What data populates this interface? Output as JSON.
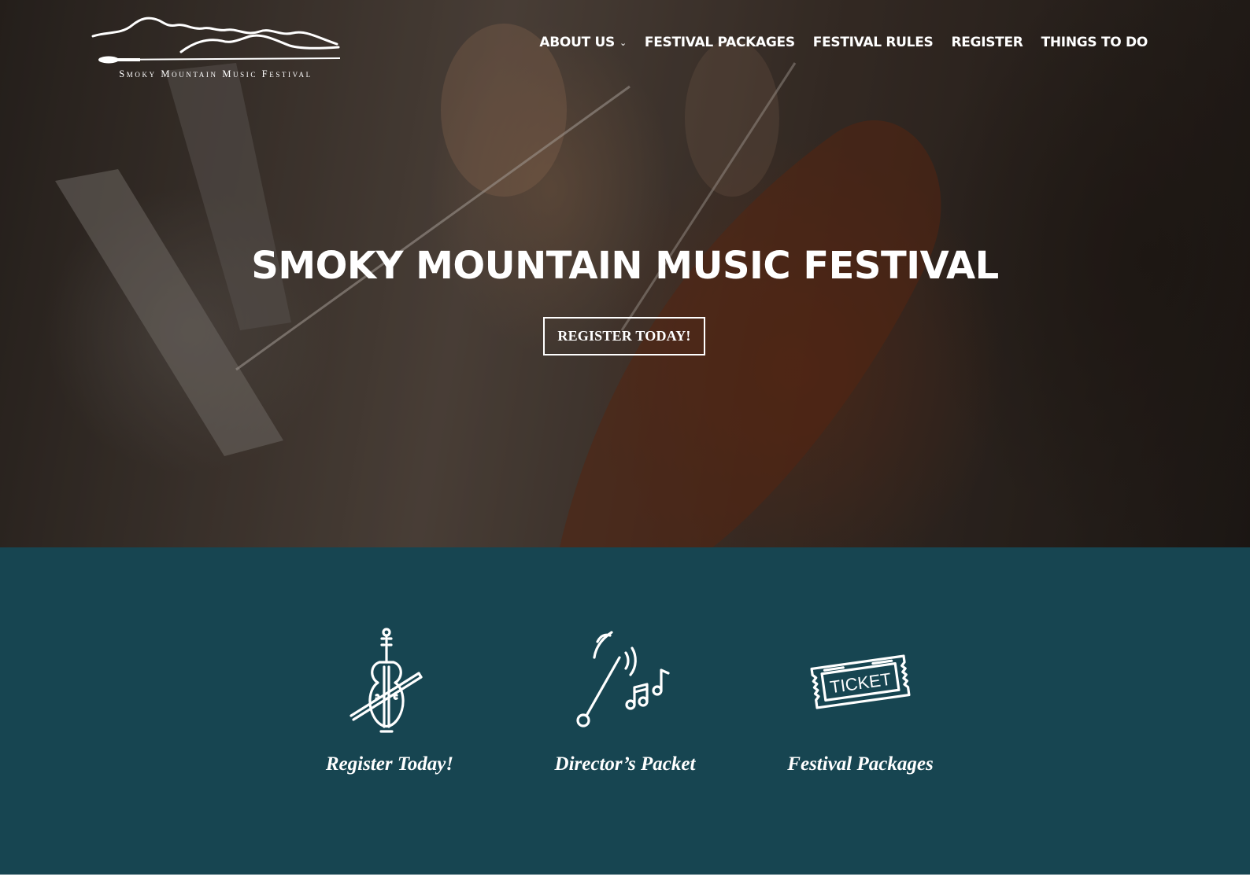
{
  "logo": {
    "text": "Smoky Mountain Music Festival",
    "icon": "mountain-baton-logo-icon"
  },
  "nav": {
    "items": [
      {
        "label": "ABOUT US",
        "has_dropdown": true
      },
      {
        "label": "FESTIVAL PACKAGES"
      },
      {
        "label": "FESTIVAL RULES"
      },
      {
        "label": "REGISTER"
      },
      {
        "label": "THINGS TO DO"
      }
    ],
    "dropdown_icon": "chevron-down-icon"
  },
  "hero": {
    "title": "SMOKY MOUNTAIN MUSIC FESTIVAL",
    "button_label": "REGISTER TODAY!"
  },
  "features": [
    {
      "label": "Register Today!",
      "icon": "cello-icon"
    },
    {
      "label": "Director’s Packet",
      "icon": "conductor-baton-music-notes-icon"
    },
    {
      "label": "Festival Packages",
      "icon": "ticket-icon"
    }
  ],
  "colors": {
    "features_background": "#174551",
    "text": "#ffffff"
  }
}
